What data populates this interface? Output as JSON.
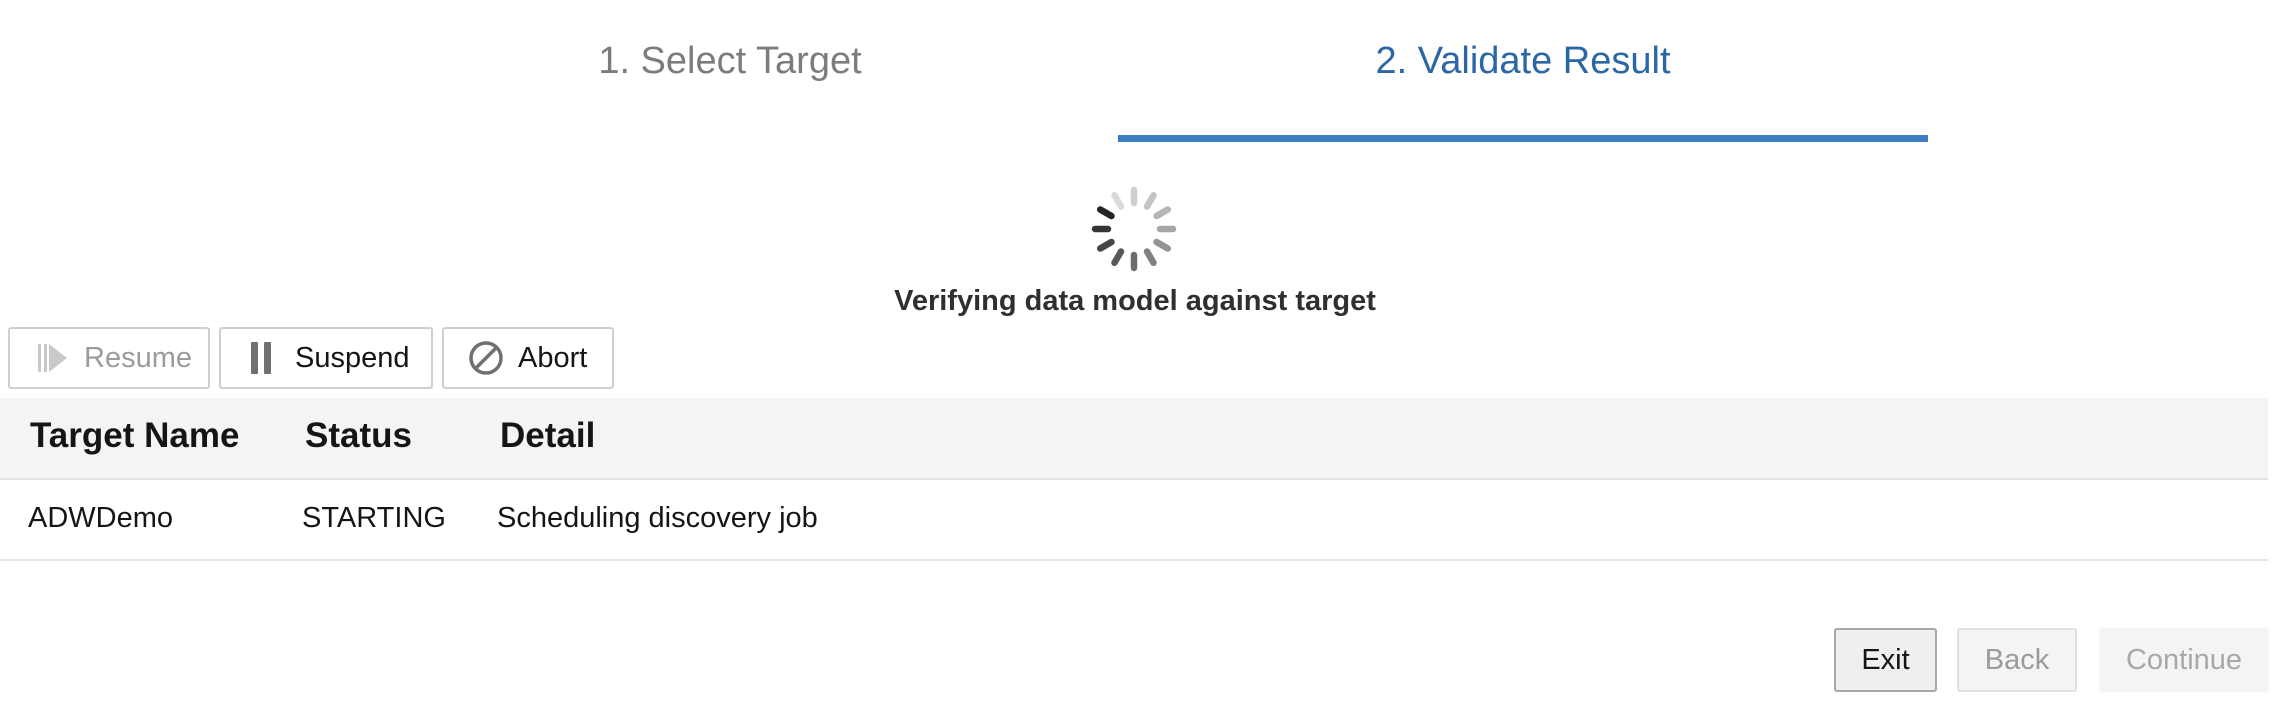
{
  "train": {
    "steps": [
      {
        "label": "1. Select Target",
        "state": "visited"
      },
      {
        "label": "2. Validate Result",
        "state": "active"
      }
    ],
    "active_color": "#2b67a6",
    "underline_color": "#3d7dc4"
  },
  "progress": {
    "icon": "spinner-icon",
    "message": "Verifying data model against target"
  },
  "toolbar": {
    "resume": {
      "label": "Resume",
      "icon": "resume-icon",
      "enabled": false
    },
    "suspend": {
      "label": "Suspend",
      "icon": "pause-icon",
      "enabled": true
    },
    "abort": {
      "label": "Abort",
      "icon": "cancel-icon",
      "enabled": true
    }
  },
  "table": {
    "columns": [
      "Target Name",
      "Status",
      "Detail"
    ],
    "rows": [
      [
        "ADWDemo",
        "STARTING",
        "Scheduling discovery job"
      ]
    ]
  },
  "footer": {
    "exit": {
      "label": "Exit",
      "enabled": true
    },
    "back": {
      "label": "Back",
      "enabled": false
    },
    "continue": {
      "label": "Continue",
      "enabled": false
    }
  }
}
